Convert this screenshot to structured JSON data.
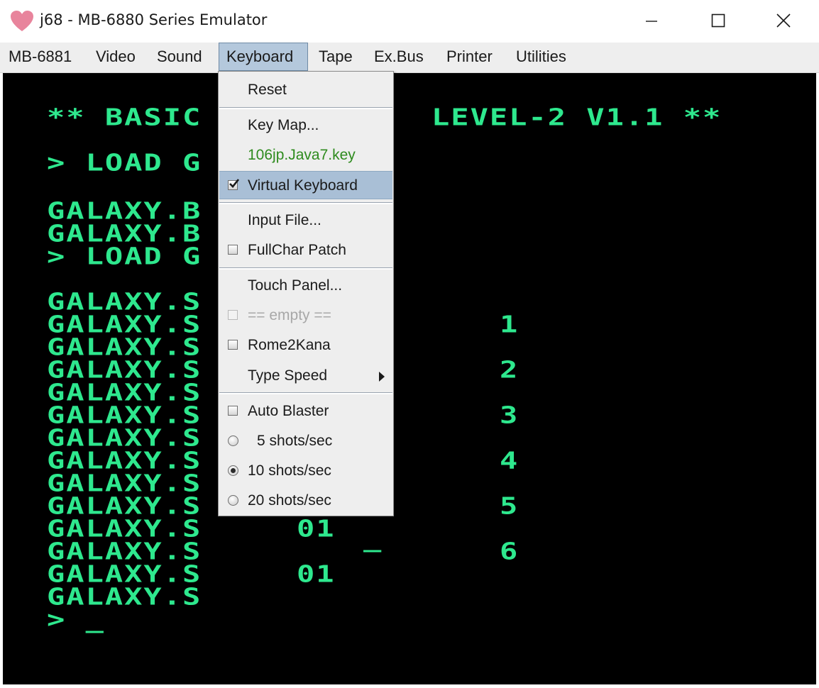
{
  "window": {
    "title": "j68 - MB-6880 Series Emulator"
  },
  "menubar": {
    "items": [
      {
        "label": "MB-6881"
      },
      {
        "label": "Video"
      },
      {
        "label": "Sound"
      },
      {
        "label": "Keyboard"
      },
      {
        "label": "Tape"
      },
      {
        "label": "Ex.Bus"
      },
      {
        "label": "Printer"
      },
      {
        "label": "Utilities"
      }
    ]
  },
  "keyboard_menu": {
    "reset": "Reset",
    "key_map": "Key Map...",
    "key_file": "106jp.Java7.key",
    "virtual_keyboard": "Virtual Keyboard",
    "input_file": "Input File...",
    "fullchar_patch": "FullChar Patch",
    "touch_panel": "Touch Panel...",
    "empty": "== empty ==",
    "rome2kana": "Rome2Kana",
    "type_speed": "Type Speed",
    "auto_blaster": "Auto Blaster",
    "shots_5": "5 shots/sec",
    "shots_10": "10 shots/sec",
    "shots_20": "20 shots/sec"
  },
  "screen": {
    "line1_left": "** BASIC",
    "line1_right": "LEVEL-2 V1.1 **",
    "line2": "> LOAD G",
    "line3": "GALAXY.B",
    "line4": "GALAXY.B",
    "line5": "> LOAD G",
    "galaxy_s": "GALAXY.S",
    "num_1": "1",
    "num_2": "2",
    "num_3": "3",
    "num_4": "4",
    "num_5": "5",
    "num_6": "6",
    "code_01": "01",
    "dash": "_",
    "prompt": "> _"
  },
  "colors": {
    "crt_green": "#2ee88e",
    "menu_bg": "#eeeeee",
    "selection": "#a9bfd6",
    "accent_green": "#2e8b1e"
  }
}
